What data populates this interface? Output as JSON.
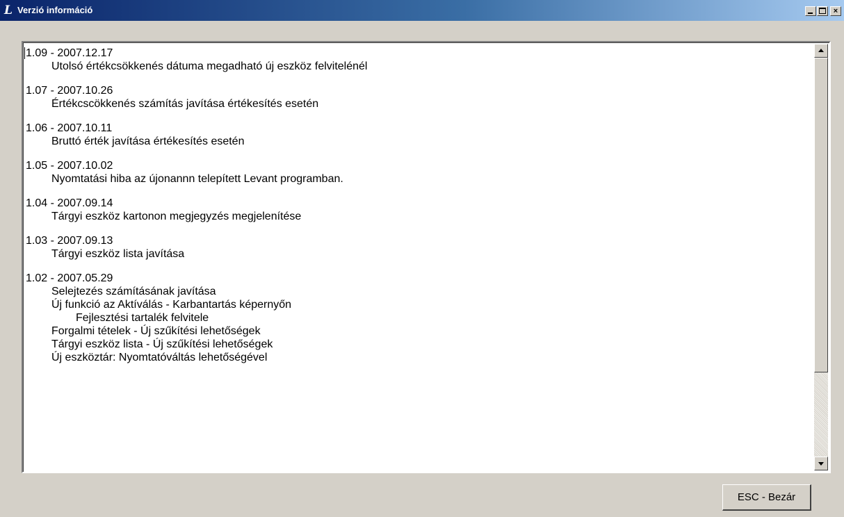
{
  "window": {
    "title": "Verzió információ",
    "app_icon": "L",
    "controls": {
      "minimize": "minimize-icon",
      "maximize": "maximize-icon",
      "close": "×"
    }
  },
  "changelog": [
    {
      "version": "1.09 - 2007.12.17",
      "items": [
        {
          "text": "Utolsó értékcsökkenés dátuma megadható új eszköz felvitelénél",
          "indent": 1
        }
      ]
    },
    {
      "version": "1.07 - 2007.10.26",
      "items": [
        {
          "text": "Értékcscökkenés számítás javítása értékesítés esetén",
          "indent": 1
        }
      ]
    },
    {
      "version": "1.06 - 2007.10.11",
      "items": [
        {
          "text": "Bruttó érték javítása értékesítés esetén",
          "indent": 1
        }
      ]
    },
    {
      "version": "1.05 - 2007.10.02",
      "items": [
        {
          "text": "Nyomtatási hiba az újonannn telepített Levant programban.",
          "indent": 1
        }
      ]
    },
    {
      "version": "1.04 - 2007.09.14",
      "items": [
        {
          "text": "Tárgyi eszköz kartonon megjegyzés megjelenítése",
          "indent": 1
        }
      ]
    },
    {
      "version": "1.03 - 2007.09.13",
      "items": [
        {
          "text": "Tárgyi eszköz lista javítása",
          "indent": 1
        }
      ]
    },
    {
      "version": "1.02 - 2007.05.29",
      "items": [
        {
          "text": "Selejtezés számításának javítása",
          "indent": 1
        },
        {
          "text": "Új funkció az Aktíválás - Karbantartás képernyőn",
          "indent": 1
        },
        {
          "text": "Fejlesztési tartalék felvitele",
          "indent": 2
        },
        {
          "text": "Forgalmi tételek - Új szűkítési lehetőségek",
          "indent": 1
        },
        {
          "text": "Tárgyi eszköz lista  - Új szűkítési lehetőségek",
          "indent": 1
        },
        {
          "text": "Új eszköztár: Nyomtatóváltás lehetőségével",
          "indent": 1
        }
      ]
    }
  ],
  "footer": {
    "close_button": "ESC - Bezár"
  }
}
